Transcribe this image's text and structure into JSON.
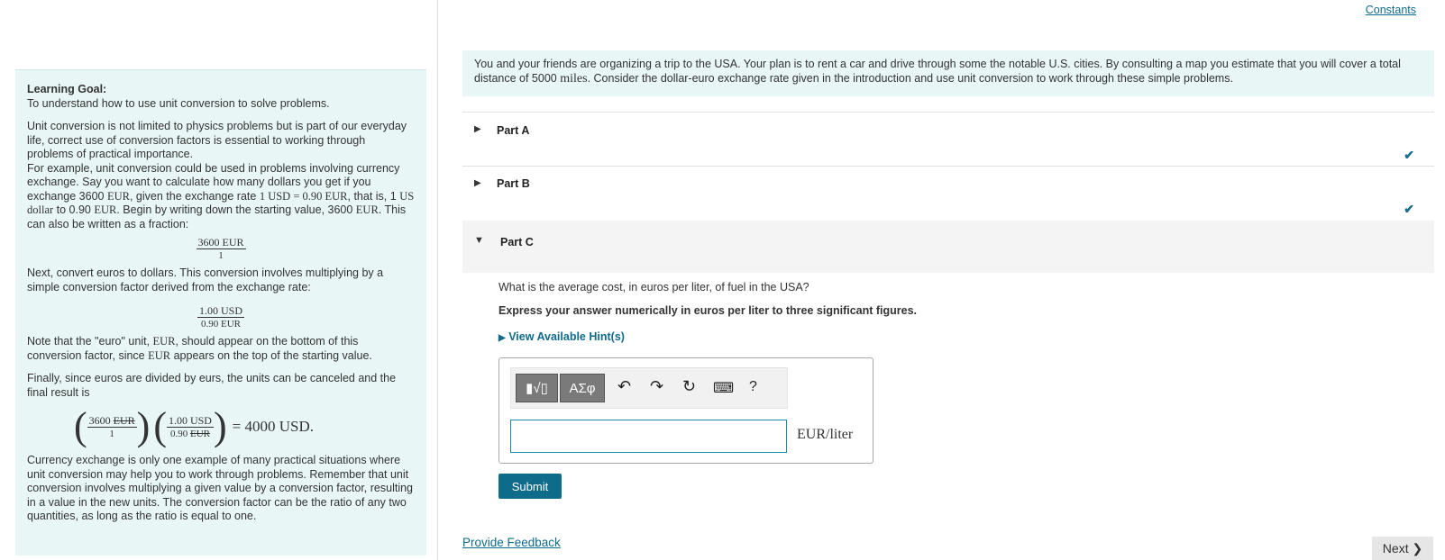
{
  "learning_goal": {
    "title": "Learning Goal:",
    "subtitle": "To understand how to use unit conversion to solve problems.",
    "p1": "Unit conversion is not limited to physics problems but is part of our everyday life, correct use of conversion factors is essential to working through problems of practical importance.",
    "p2a": "For example, unit conversion could be used in problems involving currency exchange. Say you want to calculate how many dollars you get if you exchange 3600 ",
    "p2_eur": "EUR",
    "p2b": ", given the exchange rate ",
    "p2_rate": "1 USD = 0.90 EUR",
    "p2c": ", that is, 1 ",
    "p2_usd": "US dollar",
    "p2d": " to 0.90 ",
    "p2e": ". Begin by writing down the starting value, 3600 ",
    "p2f": ". This can also be written as a fraction:",
    "frac1_num": "3600 EUR",
    "frac1_den": "1",
    "p3": "Next, convert euros to dollars. This conversion involves multiplying by a simple conversion factor derived from the exchange rate:",
    "frac2_num": "1.00 USD",
    "frac2_den": "0.90 EUR",
    "p4a": "Note that the \"euro\" unit, ",
    "p4b": ", should appear on the bottom of this conversion factor, since ",
    "p4c": " appears on the top of the starting value.",
    "p5": "Finally, since euros are divided by eurs, the units can be canceled and the final result is",
    "eq_a_num": "3600",
    "eq_a_unit": "EUR",
    "eq_a_den": "1",
    "eq_b_num": "1.00 USD",
    "eq_b_den_val": "0.90",
    "eq_b_den_unit": "EUR",
    "eq_result": "= 4000 USD.",
    "p6": "Currency exchange is only one example of many practical situations where unit conversion may help you to work through problems. Remember that unit conversion involves multiplying a given value by a conversion factor, resulting in a value in the new units. The conversion factor can be the ratio of any two quantities, as long as the ratio is equal to one."
  },
  "header": {
    "constants": "Constants"
  },
  "intro": {
    "text_a": "You and your friends are organizing a trip to the USA. Your plan is to rent a car and drive through some the notable U.S. cities. By consulting a map you estimate that you will cover a total distance of 5000 ",
    "miles": "miles",
    "text_b": ". Consider the dollar-euro exchange rate given in the introduction and use unit conversion to work through these simple problems."
  },
  "parts": [
    {
      "label": "Part A",
      "completed": true
    },
    {
      "label": "Part B",
      "completed": true
    },
    {
      "label": "Part C",
      "completed": false
    }
  ],
  "partC": {
    "question": "What is the average cost, in euros per liter, of fuel in the USA?",
    "instruction": "Express your answer numerically in euros per liter to three significant figures.",
    "hint_link": "View Available Hint(s)",
    "answer_value": "",
    "unit": "EUR/liter",
    "submit": "Submit"
  },
  "toolbar": {
    "template_btn": "▮√▯",
    "greek_btn": "ΑΣφ",
    "help": "?"
  },
  "footer": {
    "feedback": "Provide Feedback",
    "next": "Next ❯"
  },
  "colors": {
    "accent": "#0f6b8a",
    "panel_bg": "#e8f6f6"
  }
}
